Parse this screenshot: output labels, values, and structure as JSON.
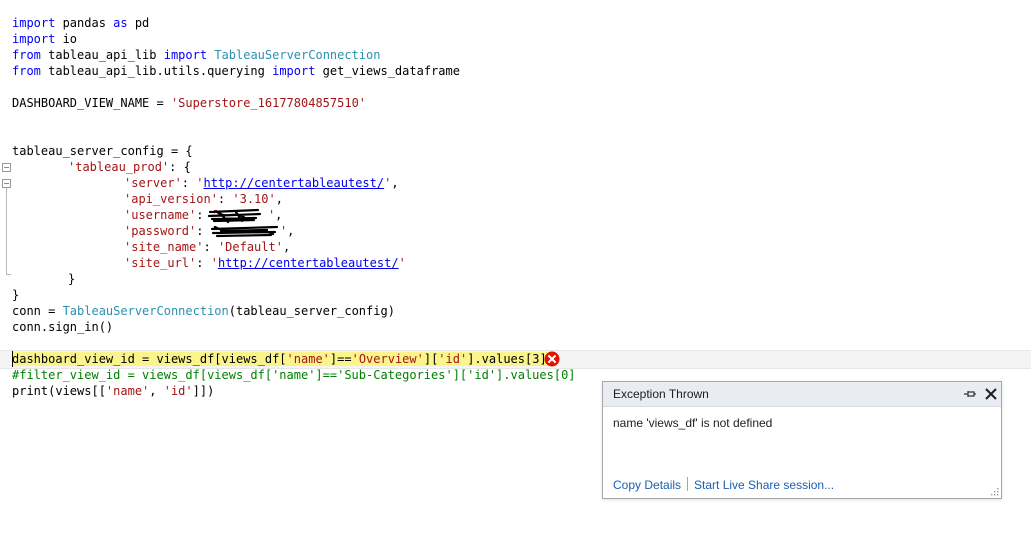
{
  "code": {
    "l1": {
      "k1": "import",
      "t1": " pandas ",
      "k2": "as",
      "t2": " pd"
    },
    "l2": {
      "k1": "import",
      "t1": " io"
    },
    "l3": {
      "k1": "from",
      "t1": " tableau_api_lib ",
      "k2": "import",
      "c1": " TableauServerConnection"
    },
    "l4": {
      "k1": "from",
      "t1": " tableau_api_lib.utils.querying ",
      "k2": "import",
      "t2": " get_views_dataframe"
    },
    "l5": {
      "t1": "DASHBOARD_VIEW_NAME = ",
      "s1": "'Superstore_16177804857510'"
    },
    "l6": {
      "t1": "tableau_server_config = {"
    },
    "l7": {
      "s1": "'tableau_prod'",
      "t1": ": {"
    },
    "l8": {
      "s1": "'server'",
      "t1": ": ",
      "s2": "'",
      "u1": "http://centertableautest/",
      "s3": "'",
      "t2": ","
    },
    "l9": {
      "s1": "'api_version'",
      "t1": ": ",
      "s2": "'3.10'",
      "t2": ","
    },
    "l10": {
      "s1": "'username'",
      "t1": ": ",
      "s2": "'",
      "s3": "'",
      "t2": ","
    },
    "l11": {
      "s1": "'password'",
      "t1": ": ",
      "s2": "'",
      "s3": "'",
      "t2": ","
    },
    "l12": {
      "s1": "'site_name'",
      "t1": ": ",
      "s2": "'Default'",
      "t2": ","
    },
    "l13": {
      "s1": "'site_url'",
      "t1": ": ",
      "s2": "'",
      "u1": "http://centertableautest/",
      "s3": "'"
    },
    "l14": {
      "t1": "}"
    },
    "l15": {
      "t1": "}"
    },
    "l16": {
      "t1": "conn = ",
      "c1": "TableauServerConnection",
      "t2": "(tableau_server_config)"
    },
    "l17": {
      "t1": "conn.sign_in()"
    },
    "l18": {
      "t1": "dashboard_view_id = views_df[views_df[",
      "s1": "'name'",
      "t2": "]==",
      "s2": "'Overview'",
      "t3": "][",
      "s3": "'id'",
      "t4": "].values[3]"
    },
    "l19": {
      "m1": "#filter_view_id = views_df[views_df['name']=='Sub-Categories']['id'].values[0]"
    },
    "l20": {
      "t1": "print(views[[",
      "s1": "'name'",
      "t2": ", ",
      "s2": "'id'",
      "t3": "]])"
    }
  },
  "exception": {
    "title": "Exception Thrown",
    "message": "name 'views_df' is not defined",
    "copy_details": "Copy Details",
    "live_share": "Start Live Share session..."
  },
  "icons": {
    "error": "error-circle-icon",
    "pin": "pin-icon",
    "close": "close-icon",
    "grip": "resize-grip-icon"
  },
  "colors": {
    "keyword": "#0000ff",
    "class": "#2b91af",
    "string": "#a31515",
    "comment": "#008000",
    "highlight": "#fbf48b",
    "error": "#e51400"
  }
}
